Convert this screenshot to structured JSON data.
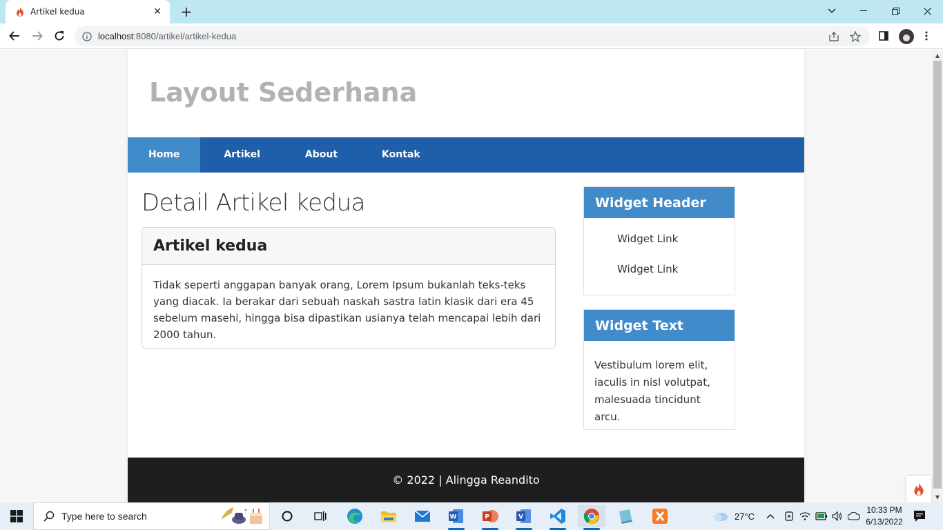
{
  "browser": {
    "tab_title": "Artikel kedua",
    "url_host": "localhost",
    "url_rest": ":8080/artikel/artikel-kedua"
  },
  "site": {
    "title": "Layout Sederhana",
    "nav": [
      {
        "label": "Home",
        "active": true
      },
      {
        "label": "Artikel",
        "active": false
      },
      {
        "label": "About",
        "active": false
      },
      {
        "label": "Kontak",
        "active": false
      }
    ],
    "page_heading": "Detail Artikel kedua",
    "article": {
      "title": "Artikel kedua",
      "body": "Tidak seperti anggapan banyak orang, Lorem Ipsum bukanlah teks-teks yang diacak. Ia berakar dari sebuah naskah sastra latin klasik dari era 45 sebelum masehi, hingga bisa dipastikan usianya telah mencapai lebih dari 2000 tahun."
    },
    "widgets": {
      "header_title": "Widget Header",
      "links": [
        "Widget Link",
        "Widget Link"
      ],
      "text_title": "Widget Text",
      "text_body": "Vestibulum lorem elit, iaculis in nisl volutpat, malesuada tincidunt arcu."
    },
    "footer": "© 2022 | Alingga Reandito"
  },
  "taskbar": {
    "search_placeholder": "Type here to search",
    "temperature": "27°C",
    "time": "10:33 PM",
    "date": "6/13/2022"
  },
  "colors": {
    "nav_bg": "#1f5faa",
    "nav_active": "#428bca",
    "widget_header": "#428bca",
    "footer_bg": "#1e1e1e",
    "site_title": "#b2b2b2"
  }
}
